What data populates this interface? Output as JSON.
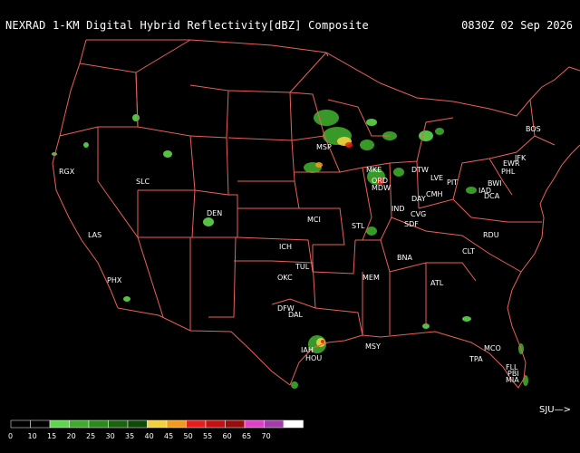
{
  "header": {
    "title": "NEXRAD 1-KM Digital Hybrid Reflectivity[dBZ] Composite",
    "timestamp": "0830Z 02 Sep 2026"
  },
  "colors": {
    "background": "#000000",
    "borders": "#e8605a",
    "text": "#ffffff"
  },
  "stations": [
    {
      "id": "RGX"
    },
    {
      "id": "SLC"
    },
    {
      "id": "LAS"
    },
    {
      "id": "PHX"
    },
    {
      "id": "DEN"
    },
    {
      "id": "ICH"
    },
    {
      "id": "TUL"
    },
    {
      "id": "OKC"
    },
    {
      "id": "DFW"
    },
    {
      "id": "DAL"
    },
    {
      "id": "IAH"
    },
    {
      "id": "HOU"
    },
    {
      "id": "MCI"
    },
    {
      "id": "STL"
    },
    {
      "id": "MSP"
    },
    {
      "id": "MKE"
    },
    {
      "id": "ORD"
    },
    {
      "id": "MDW"
    },
    {
      "id": "DTW"
    },
    {
      "id": "LVE"
    },
    {
      "id": "CMH"
    },
    {
      "id": "DAY"
    },
    {
      "id": "IND"
    },
    {
      "id": "CVG"
    },
    {
      "id": "SDF"
    },
    {
      "id": "PIT"
    },
    {
      "id": "BOS"
    },
    {
      "id": "JFK"
    },
    {
      "id": "EWR"
    },
    {
      "id": "PHL"
    },
    {
      "id": "BWI"
    },
    {
      "id": "IAD"
    },
    {
      "id": "DCA"
    },
    {
      "id": "RDU"
    },
    {
      "id": "CLT"
    },
    {
      "id": "BNA"
    },
    {
      "id": "MEM"
    },
    {
      "id": "ATL"
    },
    {
      "id": "MSY"
    },
    {
      "id": "MCO"
    },
    {
      "id": "TPA"
    },
    {
      "id": "FLL"
    },
    {
      "id": "MIA"
    },
    {
      "id": "PBI"
    }
  ],
  "legend": {
    "levels": [
      "0",
      "10",
      "15",
      "20",
      "25",
      "30",
      "35",
      "40",
      "45",
      "50",
      "55",
      "60",
      "65",
      "70"
    ],
    "colors": [
      "#000000",
      "#000000",
      "#5ed64d",
      "#3faa2c",
      "#2a8a1c",
      "#1a6410",
      "#0f4a0a",
      "#f2d23c",
      "#f29a1e",
      "#e81e1e",
      "#c31010",
      "#9a0c0c",
      "#e040c8",
      "#a23ca8",
      "#ffffff"
    ]
  },
  "nav": {
    "scroll_label": "SJU—>"
  }
}
